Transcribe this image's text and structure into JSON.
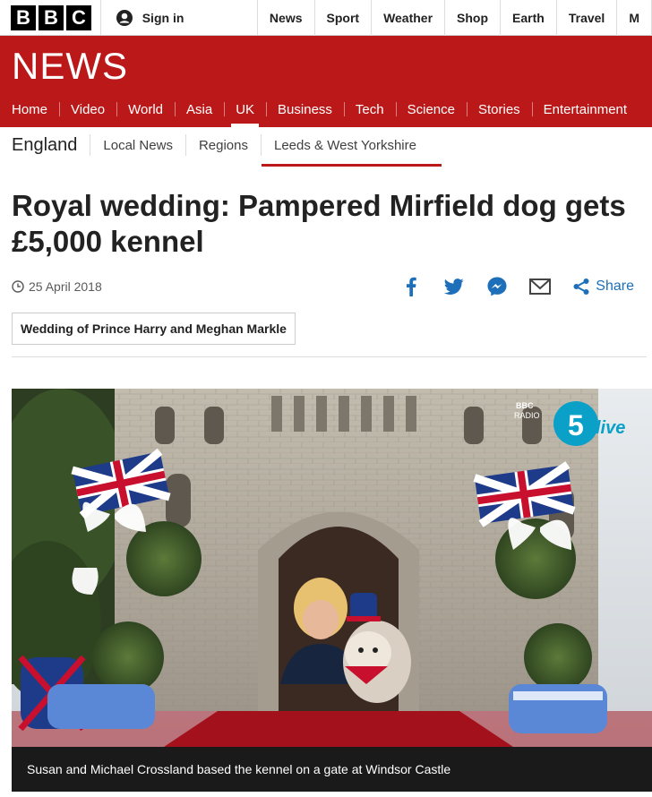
{
  "brand": {
    "letters": [
      "B",
      "B",
      "C"
    ]
  },
  "account": {
    "signin_label": "Sign in"
  },
  "top_nav": [
    "News",
    "Sport",
    "Weather",
    "Shop",
    "Earth",
    "Travel",
    "M"
  ],
  "banner": {
    "title": "NEWS"
  },
  "main_nav": {
    "items": [
      "Home",
      "Video",
      "World",
      "Asia",
      "UK",
      "Business",
      "Tech",
      "Science",
      "Stories",
      "Entertainment"
    ],
    "active": "UK"
  },
  "sub_nav": {
    "region": "England",
    "items": [
      "Local News",
      "Regions",
      "Leeds & West Yorkshire"
    ],
    "active": "Leeds & West Yorkshire"
  },
  "article": {
    "headline": "Royal wedding: Pampered Mirfield dog gets £5,000 kennel",
    "date": "25 April 2018",
    "share_label": "Share",
    "tag": "Wedding of Prince Harry and Meghan Markle"
  },
  "figure": {
    "watermark_line1": "BBC",
    "watermark_line2": "RADIO",
    "station_number": "5",
    "station_word": "live",
    "caption": "Susan and Michael Crossland based the kennel on a gate at Windsor Castle"
  },
  "colors": {
    "brand_red": "#bb1919",
    "share_blue": "#1c6fb8",
    "caption_bg": "#1a1a1a",
    "radio5_teal": "#0aa0c8"
  }
}
